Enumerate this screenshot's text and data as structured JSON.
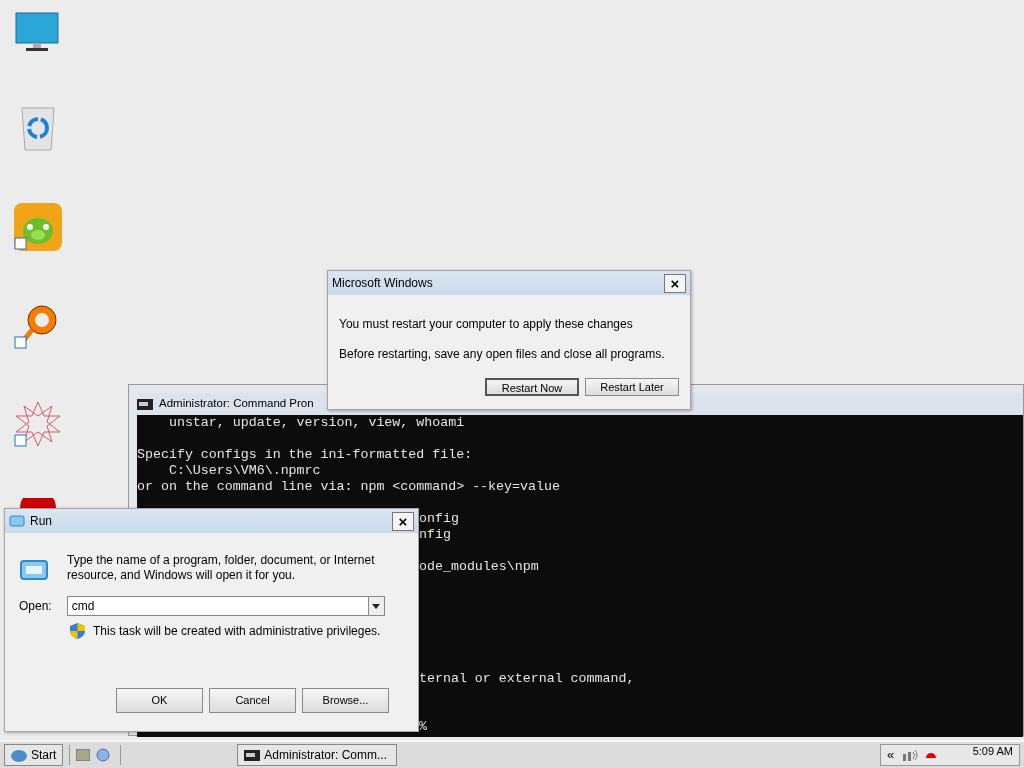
{
  "restart_dialog": {
    "title": "Microsoft Windows",
    "close": "×",
    "message": "You must restart your computer to apply these changes",
    "note": "Before restarting, save any open files and close all programs.",
    "buttons": [
      {
        "label": "Restart Now",
        "default": true
      },
      {
        "label": "Restart Later",
        "default": false
      }
    ]
  },
  "console_window": {
    "title": "Administrator:  Command Pron",
    "lines": [
      {
        "kind": "full",
        "text": "    unstar, update, version, view, whoami"
      },
      {
        "kind": "blank"
      },
      {
        "kind": "full",
        "text": "Specify configs in the ini-formatted file:"
      },
      {
        "kind": "full",
        "text": "    C:\\Users\\VM6\\.npmrc"
      },
      {
        "kind": "full",
        "text": "or on the command line via: npm <command> --key=value"
      },
      {
        "kind": "blank"
      },
      {
        "kind": "covered",
        "text": "onfig"
      },
      {
        "kind": "covered",
        "text": "nfig"
      },
      {
        "kind": "blank"
      },
      {
        "kind": "covered",
        "text": "ode_modules\\npm"
      },
      {
        "kind": "blank"
      },
      {
        "kind": "blank"
      },
      {
        "kind": "blank"
      },
      {
        "kind": "blank"
      },
      {
        "kind": "blank"
      },
      {
        "kind": "blank"
      },
      {
        "kind": "covered",
        "text": "ternal or external command,"
      },
      {
        "kind": "blank"
      },
      {
        "kind": "blank"
      },
      {
        "kind": "covered",
        "text": "%"
      }
    ]
  },
  "run_dialog": {
    "title": "Run",
    "close": "×",
    "description": "Type the name of a program, folder, document, or Internet resource, and Windows will open it for you.",
    "open_label": "Open:",
    "value": "cmd",
    "admin_note": "This task will be created with administrative privileges.",
    "buttons": [
      "OK",
      "Cancel",
      "Browse..."
    ]
  },
  "taskbar": {
    "start": "Start",
    "tasks": [
      {
        "label": "Administrator: Comm...",
        "selected": false
      }
    ],
    "tray_toggle": "«",
    "clock": "5:09 AM"
  }
}
